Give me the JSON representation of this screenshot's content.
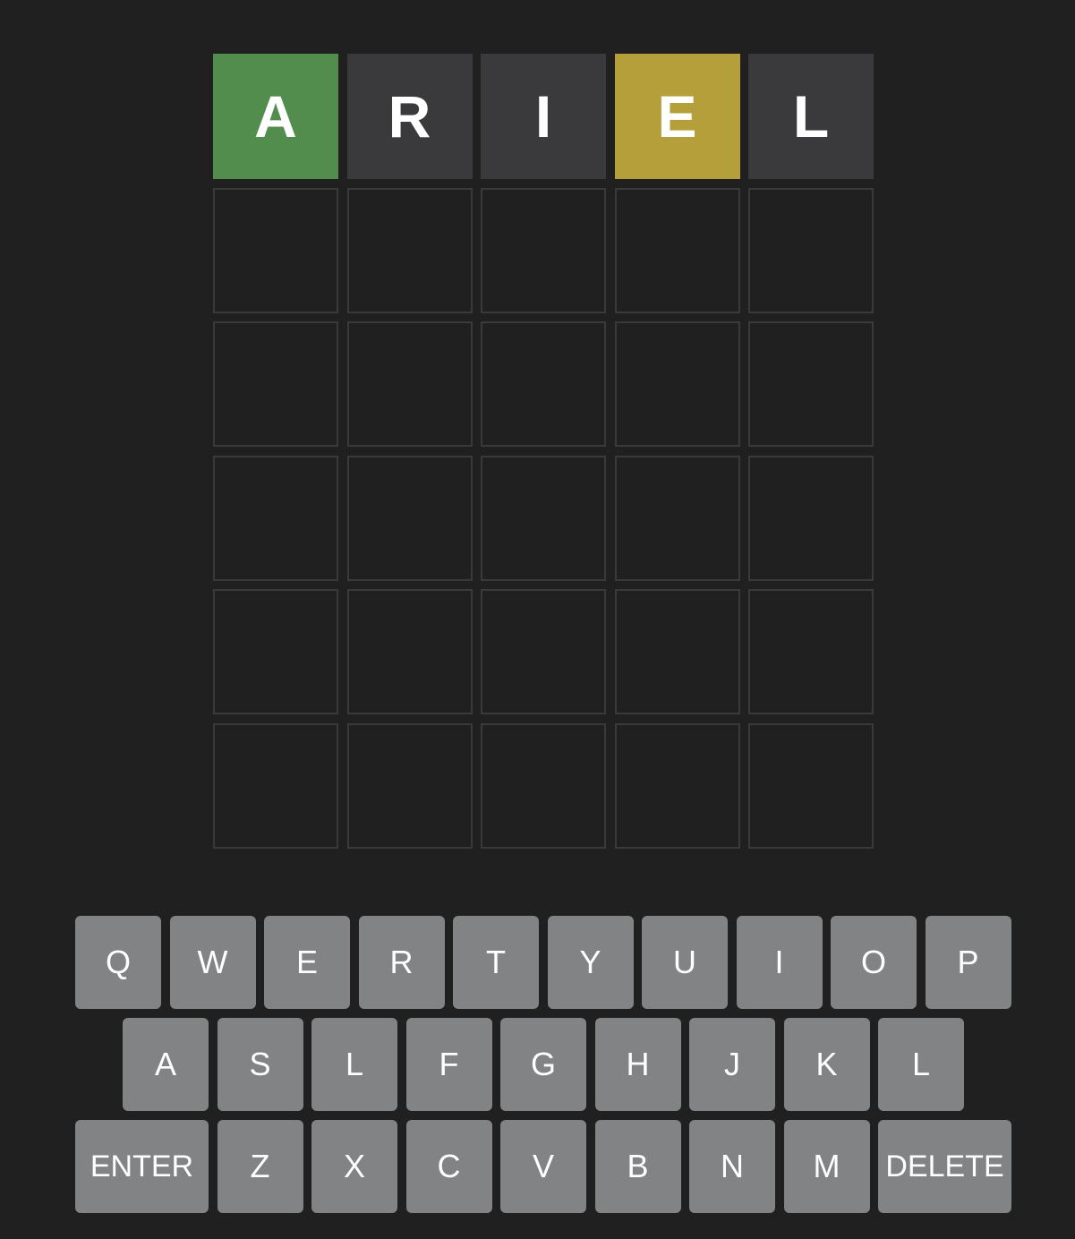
{
  "colors": {
    "background": "#1f201f",
    "correct": "#538d4e",
    "present": "#b59f3b",
    "absent": "#3a3a3c",
    "empty_border": "#3a3a3c",
    "key": "#818384",
    "text": "#ffffff"
  },
  "board": {
    "rows": [
      [
        {
          "letter": "A",
          "state": "correct"
        },
        {
          "letter": "R",
          "state": "absent"
        },
        {
          "letter": "I",
          "state": "absent"
        },
        {
          "letter": "E",
          "state": "present"
        },
        {
          "letter": "L",
          "state": "absent"
        }
      ],
      [
        {
          "letter": "",
          "state": "empty"
        },
        {
          "letter": "",
          "state": "empty"
        },
        {
          "letter": "",
          "state": "empty"
        },
        {
          "letter": "",
          "state": "empty"
        },
        {
          "letter": "",
          "state": "empty"
        }
      ],
      [
        {
          "letter": "",
          "state": "empty"
        },
        {
          "letter": "",
          "state": "empty"
        },
        {
          "letter": "",
          "state": "empty"
        },
        {
          "letter": "",
          "state": "empty"
        },
        {
          "letter": "",
          "state": "empty"
        }
      ],
      [
        {
          "letter": "",
          "state": "empty"
        },
        {
          "letter": "",
          "state": "empty"
        },
        {
          "letter": "",
          "state": "empty"
        },
        {
          "letter": "",
          "state": "empty"
        },
        {
          "letter": "",
          "state": "empty"
        }
      ],
      [
        {
          "letter": "",
          "state": "empty"
        },
        {
          "letter": "",
          "state": "empty"
        },
        {
          "letter": "",
          "state": "empty"
        },
        {
          "letter": "",
          "state": "empty"
        },
        {
          "letter": "",
          "state": "empty"
        }
      ],
      [
        {
          "letter": "",
          "state": "empty"
        },
        {
          "letter": "",
          "state": "empty"
        },
        {
          "letter": "",
          "state": "empty"
        },
        {
          "letter": "",
          "state": "empty"
        },
        {
          "letter": "",
          "state": "empty"
        }
      ]
    ]
  },
  "keyboard": {
    "row1": [
      "Q",
      "W",
      "E",
      "R",
      "T",
      "Y",
      "U",
      "I",
      "O",
      "P"
    ],
    "row2": [
      "A",
      "S",
      "L",
      "F",
      "G",
      "H",
      "J",
      "K",
      "L"
    ],
    "row3": [
      "ENTER",
      "Z",
      "X",
      "C",
      "V",
      "B",
      "N",
      "M",
      "DELETE"
    ]
  }
}
